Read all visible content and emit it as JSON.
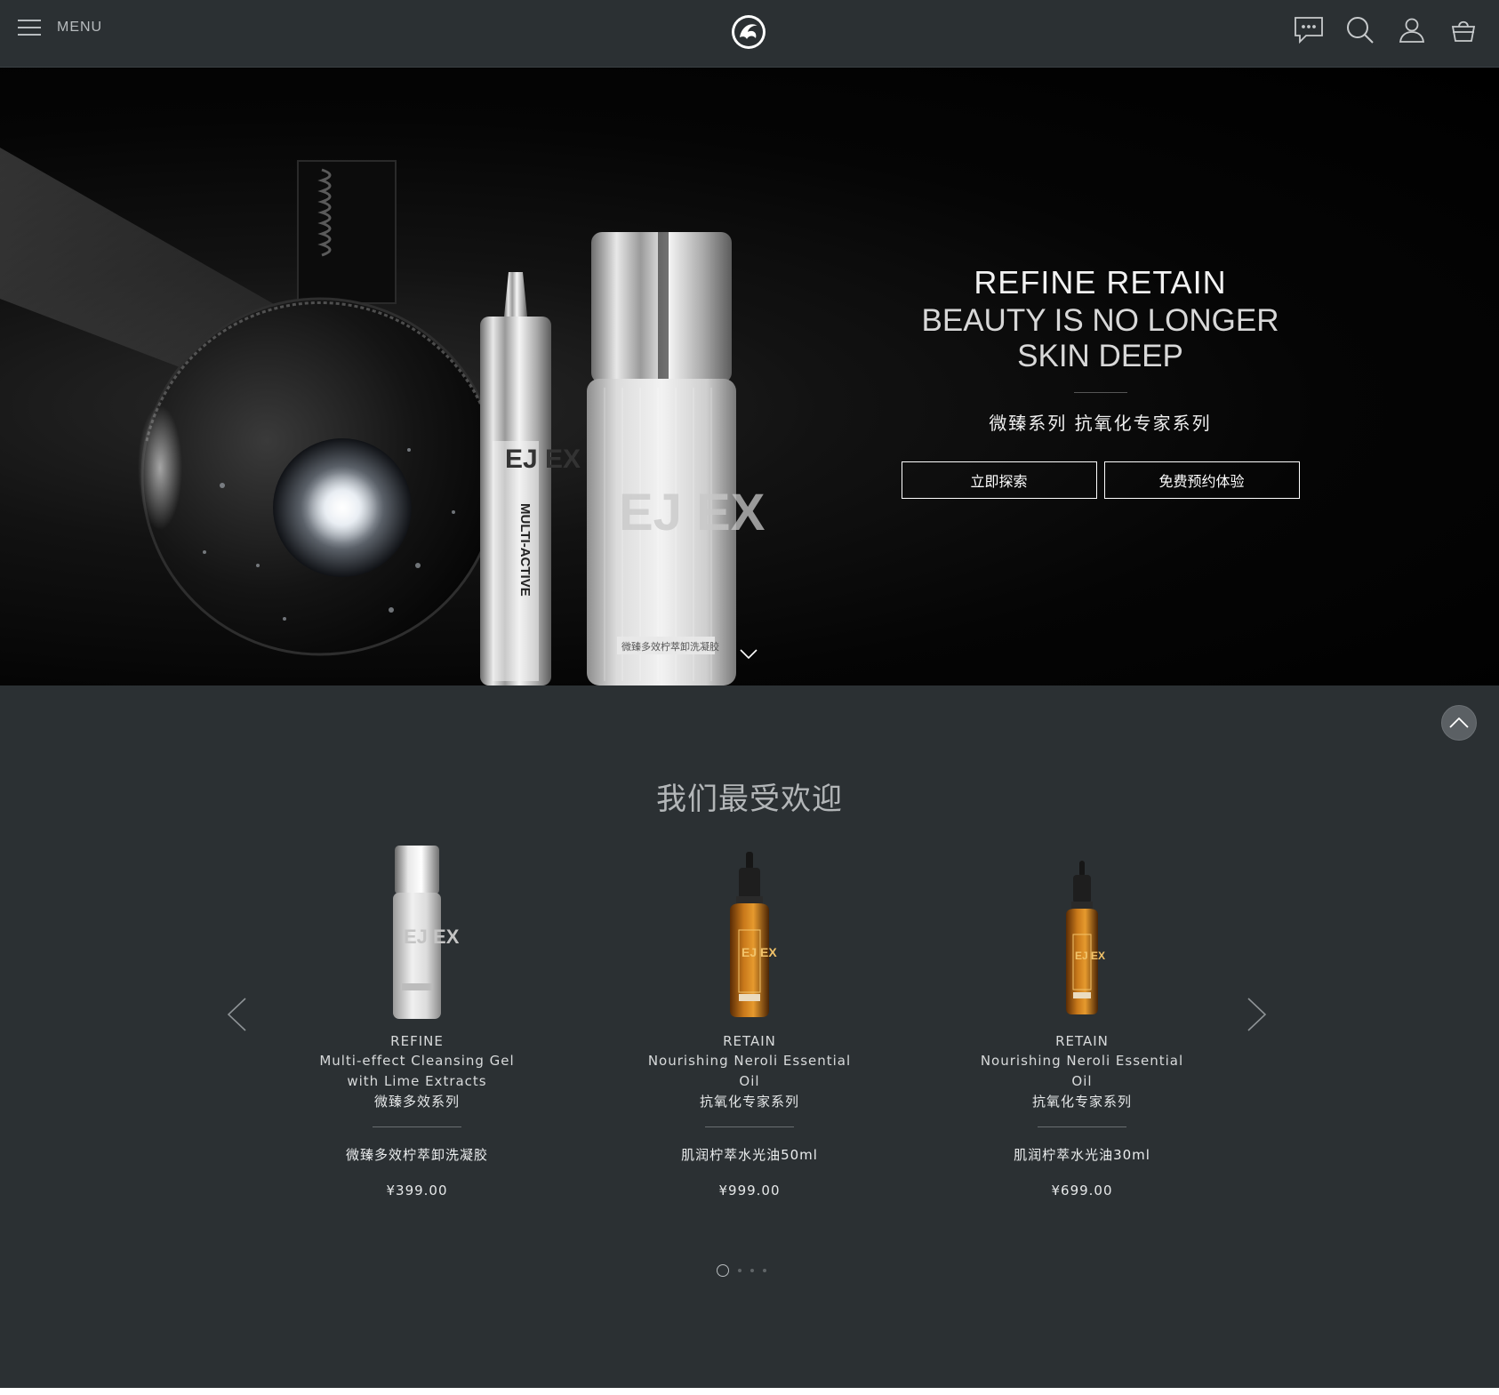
{
  "header": {
    "menu_label": "MENU",
    "icons": [
      "menu-icon",
      "logo",
      "chat-icon",
      "search-icon",
      "user-icon",
      "cart-icon"
    ]
  },
  "hero": {
    "title": "REFINE RETAIN",
    "tagline": "BEAUTY IS NO LONGER SKIN DEEP",
    "subtitle": "微臻系列 抗氧化专家系列",
    "button_explore": "立即探索",
    "button_book": "免费预约体验",
    "bottle_brand": "EJ EX",
    "tube_label": "MULTI-ACTIVE",
    "bottle_label": "微臻多效柠萃卸洗凝胶"
  },
  "popular": {
    "title": "我们最受欢迎",
    "products": [
      {
        "series_en": "REFINE",
        "name_en": "Multi-effect Cleansing Gel with Lime Extracts",
        "series_cn": "微臻多效系列",
        "name_cn": "微臻多效柠萃卸洗凝胶",
        "price": "¥399.00"
      },
      {
        "series_en": "RETAIN",
        "name_en": "Nourishing Neroli Essential Oil",
        "series_cn": "抗氧化专家系列",
        "name_cn": "肌润柠萃水光油50ml",
        "price": "¥999.00"
      },
      {
        "series_en": "RETAIN",
        "name_en": "Nourishing Neroli Essential Oil",
        "series_cn": "抗氧化专家系列",
        "name_cn": "肌润柠萃水光油30ml",
        "price": "¥699.00"
      }
    ],
    "pagination": {
      "total": 4,
      "active": 1
    }
  },
  "colors": {
    "header_bg": "#2b3033",
    "hero_bg": "#000000",
    "section_bg": "#2b3033",
    "accent_amber": "#b86a12"
  }
}
